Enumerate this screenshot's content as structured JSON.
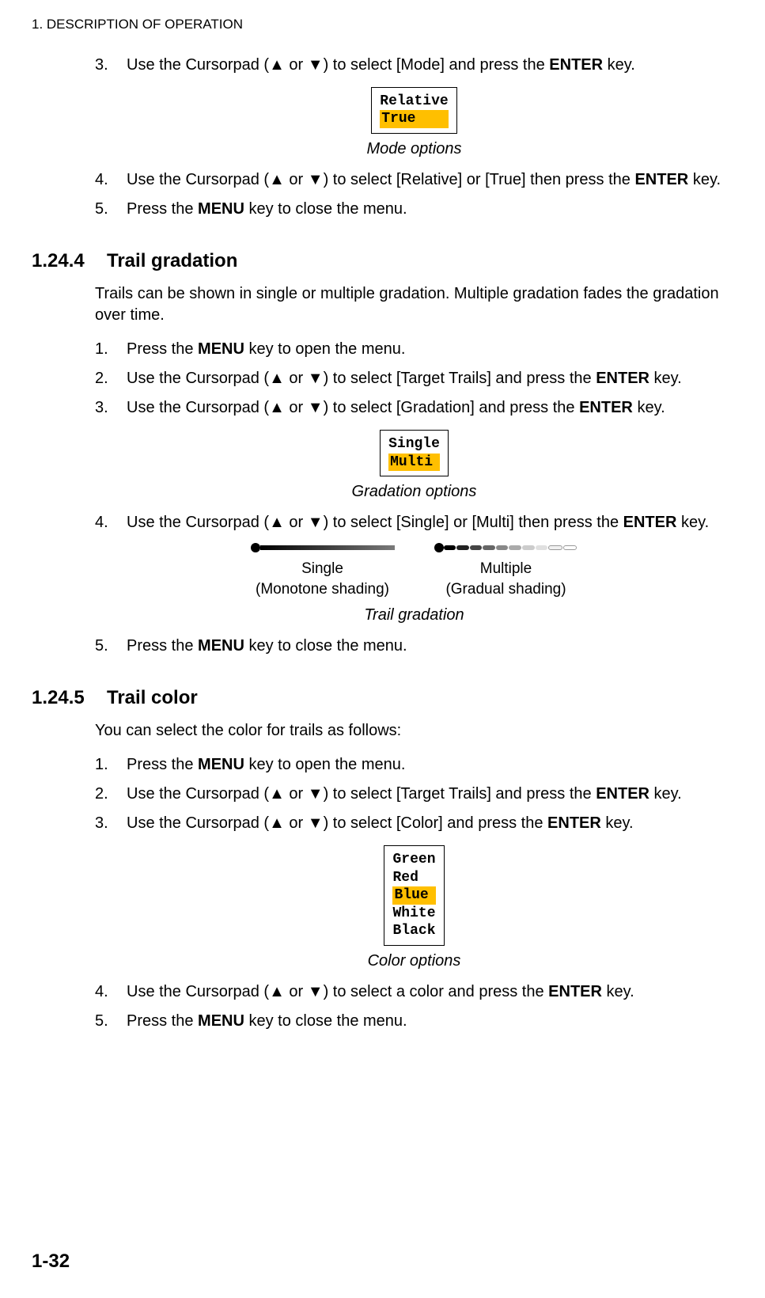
{
  "header": "1.  DESCRIPTION OF OPERATION",
  "page_number": "1-32",
  "s1": {
    "steps": [
      {
        "n": "3.",
        "pre": "Use the Cursorpad (",
        "up": "▲",
        "mid": " or ",
        "dn": "▼",
        "post": ") to select [Mode] and press the ",
        "bold": "ENTER",
        "tail": " key."
      },
      {
        "n": "4.",
        "pre": "Use the Cursorpad (",
        "up": "▲",
        "mid": " or ",
        "dn": "▼",
        "post": ") to select [Relative] or [True] then press the ",
        "bold": "ENTER",
        "tail": " key."
      },
      {
        "n": "5.",
        "pre": "Press the ",
        "bold": "MENU",
        "post": " key to close the menu."
      }
    ],
    "fig": {
      "rows": [
        "Relative",
        "True"
      ],
      "highlight_index": 1,
      "caption": "Mode options"
    }
  },
  "s2": {
    "num": "1.24.4",
    "title": "Trail gradation",
    "intro": "Trails can be shown in single or multiple gradation. Multiple gradation fades the gradation over time.",
    "stepsA": [
      {
        "n": "1.",
        "pre": "Press the ",
        "bold": "MENU",
        "post": " key to open the menu."
      },
      {
        "n": "2.",
        "pre": "Use the Cursorpad (",
        "up": "▲",
        "mid": " or ",
        "dn": "▼",
        "post": ") to select [Target Trails] and press the ",
        "bold": "ENTER",
        "tail": " key."
      },
      {
        "n": "3.",
        "pre": "Use the Cursorpad (",
        "up": "▲",
        "mid": " or ",
        "dn": "▼",
        "post": ") to select [Gradation] and press the ",
        "bold": "ENTER",
        "tail": " key."
      }
    ],
    "fig1": {
      "rows": [
        "Single",
        "Multi"
      ],
      "highlight_index": 1,
      "caption": "Gradation options"
    },
    "step4": {
      "n": "4.",
      "pre": "Use the Cursorpad (",
      "up": "▲",
      "mid": " or ",
      "dn": "▼",
      "post": ") to select [Single] or [Multi] then press the ",
      "bold": "ENTER",
      "tail": " key."
    },
    "diagram": {
      "single": {
        "label1": "Single",
        "label2": "(Monotone shading)"
      },
      "multi": {
        "label1": "Multiple",
        "label2": "(Gradual shading)"
      },
      "caption": "Trail gradation"
    },
    "step5": {
      "n": "5.",
      "pre": "Press the ",
      "bold": "MENU",
      "post": " key to close the menu."
    }
  },
  "s3": {
    "num": "1.24.5",
    "title": "Trail color",
    "intro": "You can select the color for trails as follows:",
    "stepsA": [
      {
        "n": "1.",
        "pre": "Press the ",
        "bold": "MENU",
        "post": " key to open the menu."
      },
      {
        "n": "2.",
        "pre": "Use the Cursorpad (",
        "up": "▲",
        "mid": " or ",
        "dn": "▼",
        "post": ") to select [Target Trails] and press the ",
        "bold": "ENTER",
        "tail": " key."
      },
      {
        "n": "3.",
        "pre": "Use the Cursorpad (",
        "up": "▲",
        "mid": " or ",
        "dn": "▼",
        "post": ") to select [Color] and press the ",
        "bold": "ENTER",
        "tail": " key."
      }
    ],
    "fig": {
      "rows": [
        "Green",
        "Red",
        "Blue",
        "White",
        "Black"
      ],
      "highlight_index": 2,
      "caption": "Color options"
    },
    "stepsB": [
      {
        "n": "4.",
        "pre": "Use the Cursorpad (",
        "up": "▲",
        "mid": " or ",
        "dn": "▼",
        "post": ") to select a color and press the ",
        "bold": "ENTER",
        "tail": " key."
      },
      {
        "n": "5.",
        "pre": "Press the ",
        "bold": "MENU",
        "post": " key to close the menu."
      }
    ]
  }
}
